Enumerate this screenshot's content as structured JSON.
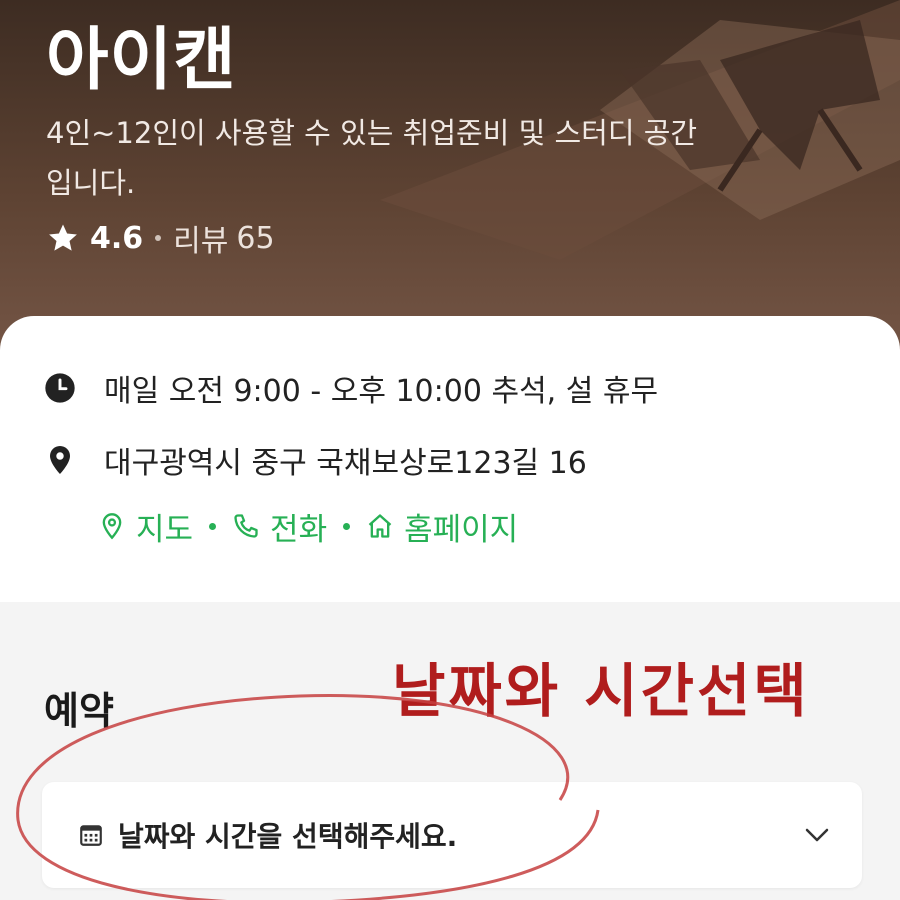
{
  "hero": {
    "title": "아이캔",
    "description": "4인~12인이 사용할 수 있는 취업준비 및 스터디 공간 입니다.",
    "rating": "4.6",
    "review_label": "리뷰",
    "review_count": "65",
    "icon": "star-icon"
  },
  "info": {
    "hours": "매일 오전 9:00 - 오후 10:00 추석, 설 휴무",
    "hours_icon": "clock-icon",
    "address": "대구광역시 중구 국채보상로123길 16",
    "address_icon": "map-pin-icon",
    "links": [
      {
        "label": "지도",
        "icon": "map-pin-outline-icon"
      },
      {
        "label": "전화",
        "icon": "phone-icon"
      },
      {
        "label": "홈페이지",
        "icon": "home-icon"
      }
    ],
    "link_color": "#27b055"
  },
  "reservation": {
    "title": "예약",
    "annotation": "날짜와 시간선택",
    "annotation_color": "#b01d1d",
    "select_placeholder": "날짜와 시간을 선택해주세요.",
    "select_icon": "calendar-icon",
    "dropdown_icon": "chevron-down-icon"
  }
}
